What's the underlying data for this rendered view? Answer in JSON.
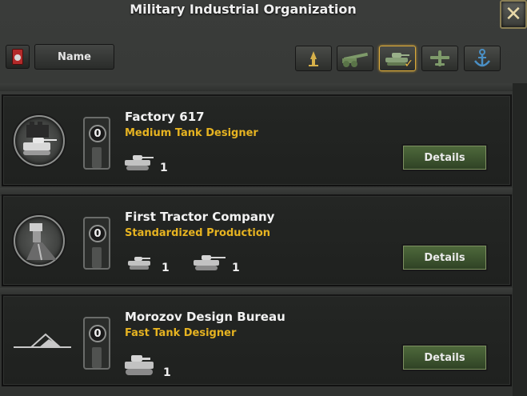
{
  "window": {
    "title": "Military Industrial Organization",
    "close_icon": "close-icon"
  },
  "toolbar": {
    "sort_label": "Name",
    "filters": [
      {
        "name": "army-filter",
        "icon": "infantry-icon",
        "active": false
      },
      {
        "name": "artillery-filter",
        "icon": "artillery-icon",
        "active": false
      },
      {
        "name": "armor-filter",
        "icon": "tank-icon",
        "active": true
      },
      {
        "name": "air-filter",
        "icon": "plane-icon",
        "active": false
      },
      {
        "name": "naval-filter",
        "icon": "anchor-icon",
        "active": false
      }
    ]
  },
  "organizations": [
    {
      "name": "Factory 617",
      "trait": "Medium Tank Designer",
      "slot_count": "0",
      "equipment": [
        {
          "icon": "medium-tank-icon",
          "count": "1"
        }
      ],
      "details_label": "Details"
    },
    {
      "name": "First Tractor Company",
      "trait": "Standardized Production",
      "slot_count": "0",
      "equipment": [
        {
          "icon": "light-tank-icon",
          "count": "1"
        },
        {
          "icon": "medium-tank-icon",
          "count": "1"
        }
      ],
      "details_label": "Details"
    },
    {
      "name": "Morozov Design Bureau",
      "trait": "Fast Tank Designer",
      "slot_count": "0",
      "equipment": [
        {
          "icon": "heavy-tank-icon",
          "count": "1"
        }
      ],
      "details_label": "Details"
    }
  ],
  "colors": {
    "trait": "#e6b321",
    "details_button": "#3e5630",
    "active_filter_border": "#d9a93a"
  }
}
